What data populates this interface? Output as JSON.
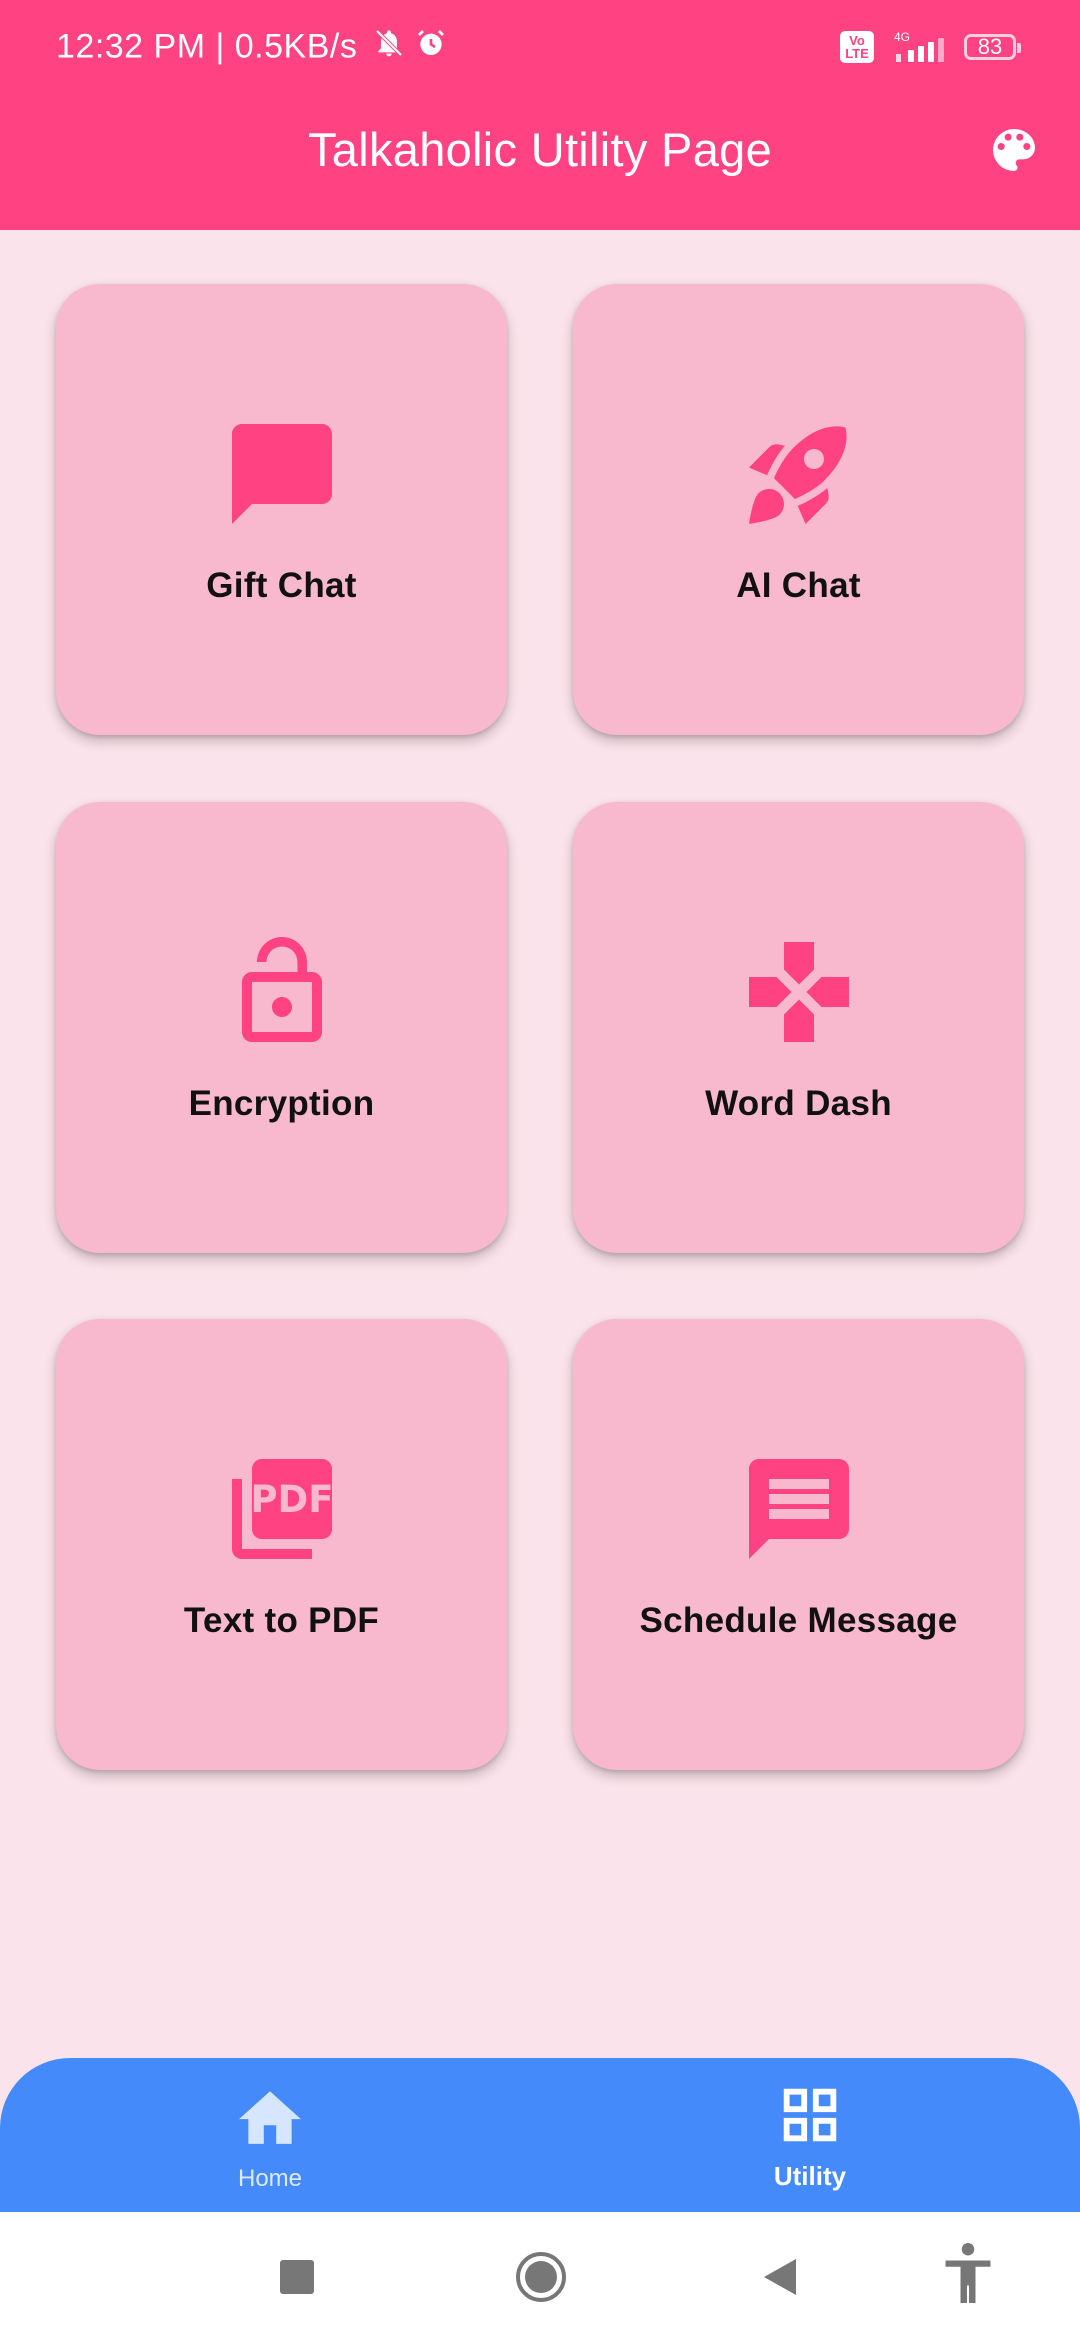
{
  "status_bar": {
    "time_speed": "12:32 PM | 0.5KB/s",
    "network": "4G",
    "volte": "Vo\nLTE",
    "battery": "83"
  },
  "app_bar": {
    "title": "Talkaholic Utility Page",
    "action_icon": "palette-icon"
  },
  "tiles": [
    {
      "label": "Gift Chat",
      "icon": "chat-bubble-icon"
    },
    {
      "label": "AI Chat",
      "icon": "rocket-icon"
    },
    {
      "label": "Encryption",
      "icon": "lock-open-icon"
    },
    {
      "label": "Word Dash",
      "icon": "gamepad-icon"
    },
    {
      "label": "Text to PDF",
      "icon": "pdf-icon"
    },
    {
      "label": "Schedule Message",
      "icon": "message-icon"
    }
  ],
  "bottom_nav": {
    "items": [
      {
        "label": "Home",
        "icon": "home-icon",
        "selected": false
      },
      {
        "label": "Utility",
        "icon": "grid-icon",
        "selected": true
      }
    ]
  },
  "colors": {
    "primary": "#FF4281",
    "card": "#F8B8CD",
    "background": "#FAE3EA",
    "nav": "#448AFB"
  }
}
